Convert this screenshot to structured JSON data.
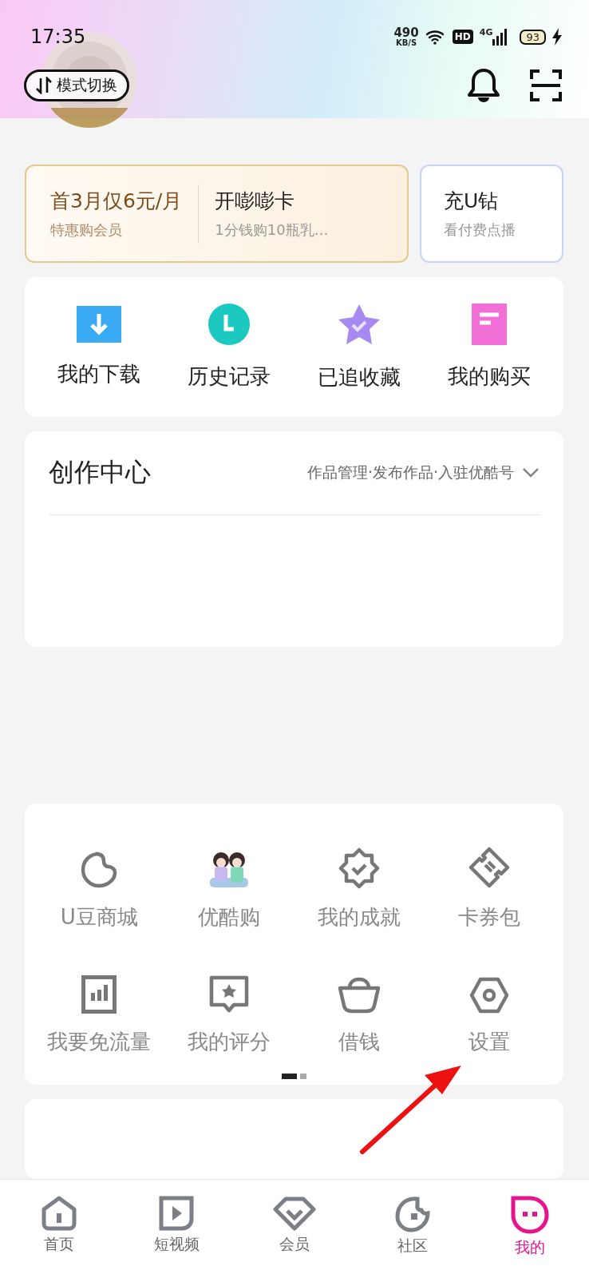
{
  "status_bar": {
    "time": "17:35",
    "net_speed": "490",
    "net_unit": "KB/S",
    "hd": "HD",
    "network": "4G",
    "battery": "93"
  },
  "header": {
    "mode_button": "模式切换"
  },
  "promos": [
    {
      "title": "首3月仅6元/月",
      "subtitle": "特惠购会员"
    },
    {
      "title": "开嘭嘭卡",
      "subtitle": "1分钱购10瓶乳…"
    },
    {
      "title": "充U钻",
      "subtitle": "看付费点播"
    }
  ],
  "quick_links": [
    {
      "label": "我的下载"
    },
    {
      "label": "历史记录"
    },
    {
      "label": "已追收藏"
    },
    {
      "label": "我的购买"
    }
  ],
  "creation_center": {
    "title": "创作中心",
    "links": "作品管理·发布作品·入驻优酷号",
    "expanded": false
  },
  "services": [
    {
      "label": "U豆商城"
    },
    {
      "label": "优酷购"
    },
    {
      "label": "我的成就"
    },
    {
      "label": "卡券包"
    },
    {
      "label": "我要免流量"
    },
    {
      "label": "我的评分"
    },
    {
      "label": "借钱"
    },
    {
      "label": "设置"
    }
  ],
  "pager": [
    {
      "selected": true
    },
    {
      "selected": false
    }
  ],
  "bottom_nav": [
    {
      "label": "首页",
      "selected": false
    },
    {
      "label": "短视频",
      "selected": false
    },
    {
      "label": "会员",
      "selected": false
    },
    {
      "label": "社区",
      "selected": false
    },
    {
      "label": "我的",
      "selected": true
    }
  ]
}
